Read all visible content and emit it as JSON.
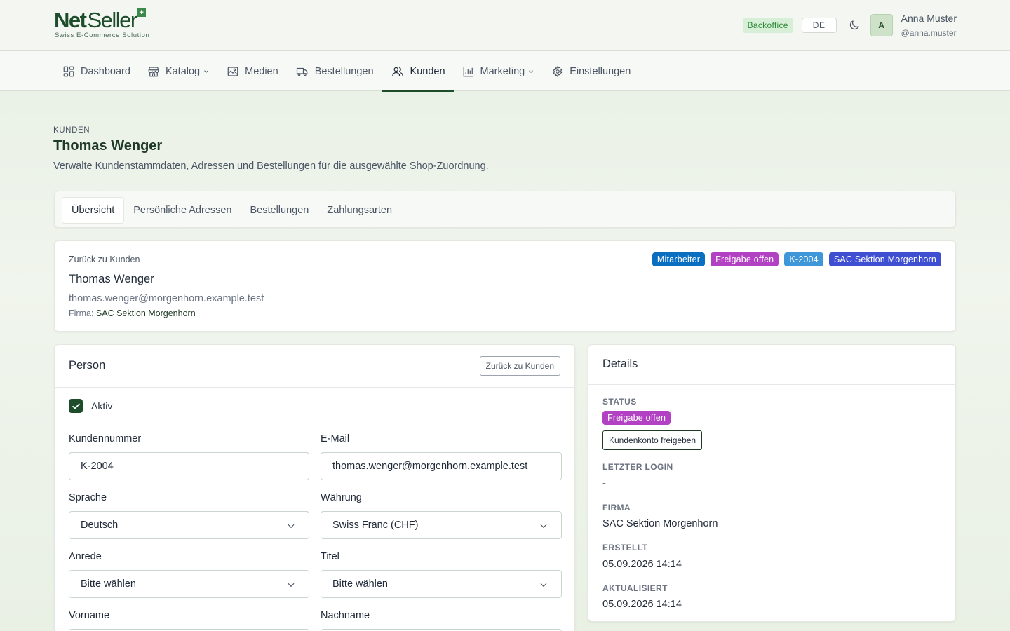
{
  "brand": {
    "word_a": "Net",
    "word_b": "Seller",
    "plus": "+",
    "tagline": "Swiss E-Commerce Solution"
  },
  "header": {
    "env_badge": "Backoffice",
    "language": "DE",
    "avatar_initial": "A",
    "user_name": "Anna Muster",
    "user_handle": "@anna.muster"
  },
  "nav": {
    "items": [
      {
        "label": "Dashboard",
        "icon": "dashboard-icon"
      },
      {
        "label": "Katalog",
        "icon": "store-icon",
        "dropdown": true
      },
      {
        "label": "Medien",
        "icon": "image-icon"
      },
      {
        "label": "Bestellungen",
        "icon": "truck-icon"
      },
      {
        "label": "Kunden",
        "icon": "users-icon",
        "active": true
      },
      {
        "label": "Marketing",
        "icon": "chart-icon",
        "dropdown": true
      },
      {
        "label": "Einstellungen",
        "icon": "gear-icon"
      }
    ]
  },
  "page": {
    "breadcrumb": "KUNDEN",
    "title": "Thomas Wenger",
    "description": "Verwalte Kundenstammdaten, Adressen und Bestellungen für die ausgewählte Shop-Zuordnung."
  },
  "tabs": [
    "Übersicht",
    "Persönliche Adressen",
    "Bestellungen",
    "Zahlungsarten"
  ],
  "summary": {
    "back_link": "Zurück zu Kunden",
    "name": "Thomas Wenger",
    "email": "thomas.wenger@morgenhorn.example.test",
    "firma_label": "Firma:",
    "firma_value": "SAC Sektion Morgenhorn",
    "badges": [
      {
        "label": "Mitarbeiter",
        "color": "#0b6fc1"
      },
      {
        "label": "Freigabe offen",
        "color": "#b341c3"
      },
      {
        "label": "K-2004",
        "color": "#3f97d9"
      },
      {
        "label": "SAC Sektion Morgenhorn",
        "color": "#3f4fd1"
      }
    ]
  },
  "person": {
    "title": "Person",
    "back_button": "Zurück zu Kunden",
    "active_label": "Aktiv",
    "fields": {
      "kundennummer": {
        "label": "Kundennummer",
        "value": "K-2004"
      },
      "email": {
        "label": "E-Mail",
        "value": "thomas.wenger@morgenhorn.example.test"
      },
      "sprache": {
        "label": "Sprache",
        "value": "Deutsch"
      },
      "waehrung": {
        "label": "Währung",
        "value": "Swiss Franc (CHF)"
      },
      "anrede": {
        "label": "Anrede",
        "value": "Bitte wählen"
      },
      "titel": {
        "label": "Titel",
        "value": "Bitte wählen"
      },
      "vorname": {
        "label": "Vorname"
      },
      "nachname": {
        "label": "Nachname"
      }
    }
  },
  "details": {
    "title": "Details",
    "status_label": "STATUS",
    "status_badge": "Freigabe offen",
    "status_color": "#b341c3",
    "release_button": "Kundenkonto freigeben",
    "last_login_label": "LETZTER LOGIN",
    "last_login_value": "-",
    "firma_label": "FIRMA",
    "firma_value": "SAC Sektion Morgenhorn",
    "created_label": "ERSTELLT",
    "created_value": "05.09.2026 14:14",
    "updated_label": "AKTUALISIERT",
    "updated_value": "05.09.2026 14:14"
  },
  "colors": {
    "brand": "#1e4d2b",
    "accent_green": "#2f8a3b"
  }
}
